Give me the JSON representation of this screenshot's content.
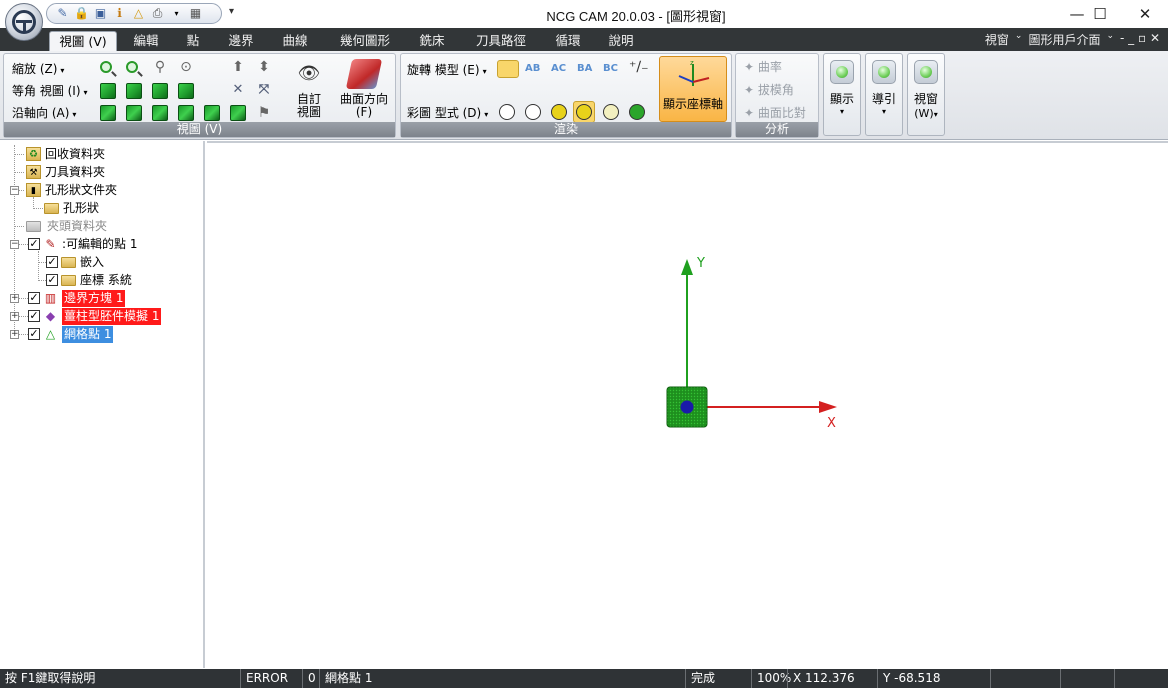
{
  "window": {
    "title": "NCG CAM 20.0.03 - [圖形視窗]",
    "minimize": "—",
    "maximize": "☐",
    "close": "✕"
  },
  "qat": {
    "more": "▾"
  },
  "tabs": [
    {
      "label": "視圖 (V)",
      "active": true
    },
    {
      "label": "編輯"
    },
    {
      "label": "點"
    },
    {
      "label": "邊界"
    },
    {
      "label": "曲線"
    },
    {
      "label": "幾何圖形"
    },
    {
      "label": "銑床"
    },
    {
      "label": "刀具路徑"
    },
    {
      "label": "循環"
    },
    {
      "label": "說明"
    }
  ],
  "tabrow_right": {
    "view": "視窗",
    "ui": "圖形用戶介面",
    "ctrls": "- _ ▫ ✕"
  },
  "ribbon": {
    "view_group": {
      "label": "視圖 (V)",
      "zoom": "縮放 (Z)",
      "iso_view": "等角 視圖 (I)",
      "axis_view": "沿軸向 (A)",
      "custom_view": [
        "自訂",
        "視圖"
      ],
      "surface_dir": [
        "曲面方向",
        "(F)"
      ]
    },
    "render_group": {
      "label": "渲染",
      "rotate_model": "旋轉 模型 (E)",
      "shade_style": "彩圖 型式 (D)",
      "show_axes": "顯示座標軸",
      "icons_ab": [
        "AB",
        "AC",
        "BA",
        "BC"
      ]
    },
    "analysis_group": {
      "label": "分析",
      "curvature": "曲率",
      "draft_angle": "拔模角",
      "surface_compare": "曲面比對"
    },
    "display_btn": "顯示",
    "guide_btn": "導引",
    "window_btn": [
      "視窗",
      "(W)"
    ]
  },
  "tree": [
    {
      "label": "回收資料夾"
    },
    {
      "label": "刀具資料夾"
    },
    {
      "label": "孔形狀文件夾"
    },
    {
      "label": "孔形狀"
    },
    {
      "label": "夾頭資料夾"
    },
    {
      "label": ":可編輯的點 1"
    },
    {
      "label": "嵌入"
    },
    {
      "label": "座標 系統"
    },
    {
      "label": "邊界方塊 1"
    },
    {
      "label": "薑柱型胚件模擬 1"
    },
    {
      "label": "網格點 1"
    }
  ],
  "viewport": {
    "y_axis": "Y",
    "x_axis": "X",
    "axis_color_x": "#d42020",
    "axis_color_y": "#1fa01f"
  },
  "status": {
    "help": "按 F1鍵取得說明",
    "error": "ERROR",
    "count": "0",
    "selection": "網格點 1",
    "state": "完成",
    "zoom": "100%",
    "x": "X 112.376",
    "y": "Y -68.518"
  }
}
